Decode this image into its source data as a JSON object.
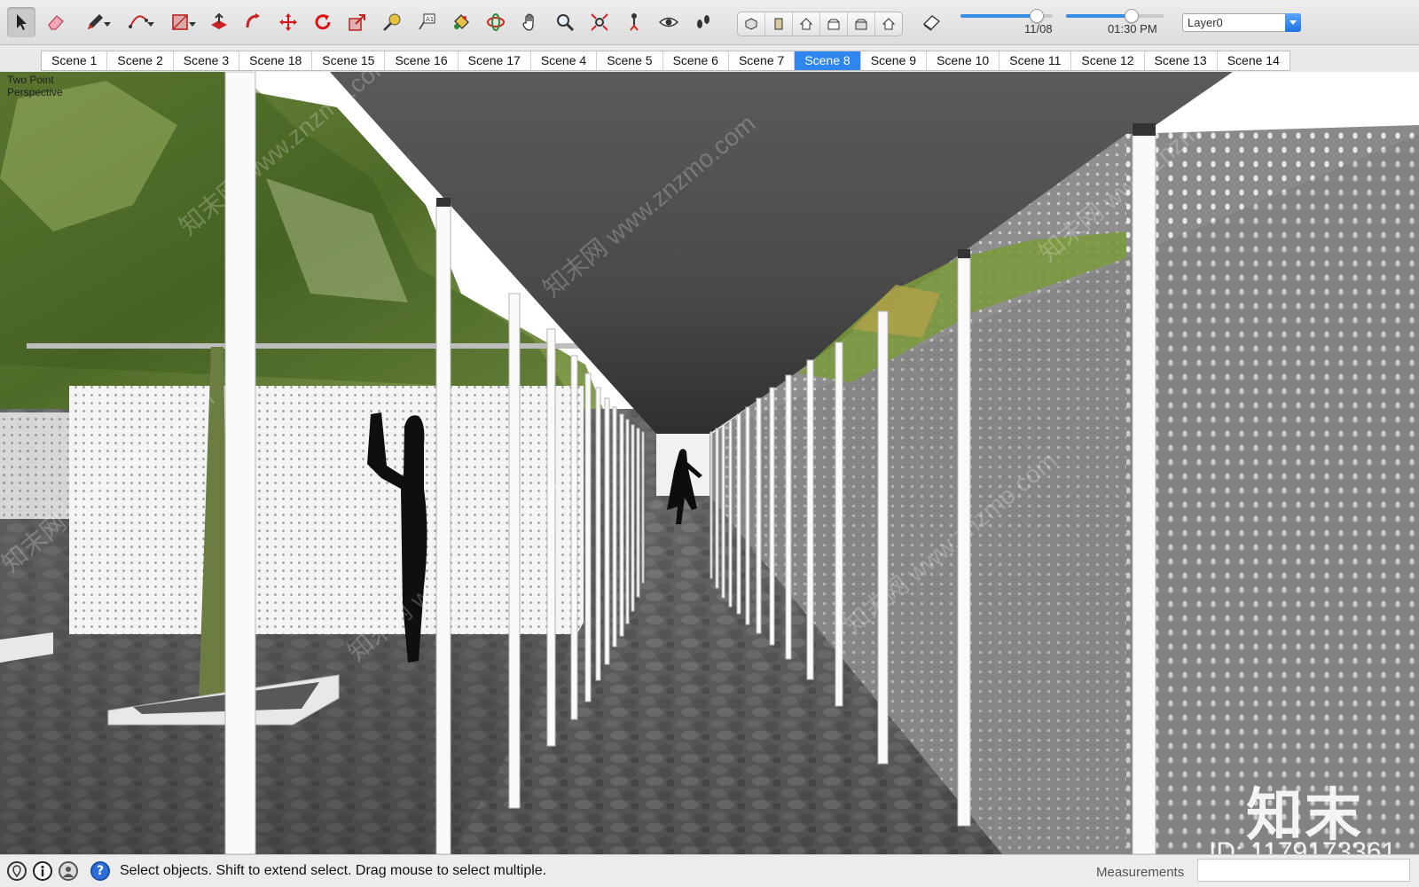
{
  "toolbar": {
    "tools": [
      {
        "name": "select-tool",
        "icon": "arrow-cursor-icon"
      },
      {
        "name": "eraser-tool",
        "icon": "eraser-icon"
      },
      {
        "name": "line-tool",
        "icon": "pencil-icon"
      },
      {
        "name": "arc-tool",
        "icon": "arc-icon"
      },
      {
        "name": "rectangle-tool",
        "icon": "rectangle-icon"
      },
      {
        "name": "push-pull-tool",
        "icon": "push-pull-icon"
      },
      {
        "name": "follow-me-tool",
        "icon": "follow-me-icon"
      },
      {
        "name": "move-tool",
        "icon": "move-icon"
      },
      {
        "name": "rotate-tool",
        "icon": "rotate-icon"
      },
      {
        "name": "scale-tool",
        "icon": "scale-icon"
      },
      {
        "name": "tape-measure-tool",
        "icon": "tape-measure-icon"
      },
      {
        "name": "text-tool",
        "icon": "text-icon"
      },
      {
        "name": "paint-bucket-tool",
        "icon": "paint-bucket-icon"
      },
      {
        "name": "orbit-tool",
        "icon": "orbit-icon"
      },
      {
        "name": "pan-tool",
        "icon": "hand-icon"
      },
      {
        "name": "zoom-tool",
        "icon": "magnifier-icon"
      },
      {
        "name": "zoom-extents-tool",
        "icon": "zoom-extents-icon"
      },
      {
        "name": "position-camera-tool",
        "icon": "position-camera-icon"
      },
      {
        "name": "look-around-tool",
        "icon": "eye-icon"
      },
      {
        "name": "walk-tool",
        "icon": "footprints-icon"
      }
    ],
    "views": [
      "iso-view-icon",
      "top-view-icon",
      "front-view-icon",
      "right-view-icon",
      "back-view-icon",
      "left-view-icon"
    ],
    "date_label": "11/08",
    "time_label": "01:30 PM",
    "date_progress": 0.82,
    "time_progress": 0.66,
    "layer": "Layer0",
    "accent": "#2f86f0"
  },
  "scenes": {
    "tabs": [
      "Scene 1",
      "Scene 2",
      "Scene 3",
      "Scene 18",
      "Scene 15",
      "Scene 16",
      "Scene 17",
      "Scene 4",
      "Scene 5",
      "Scene 6",
      "Scene 7",
      "Scene 8",
      "Scene 9",
      "Scene 10",
      "Scene 11",
      "Scene 12",
      "Scene 13",
      "Scene 14"
    ],
    "active": "Scene 8"
  },
  "viewport": {
    "camera_label": "Two Point Perspective"
  },
  "watermark": {
    "repeat_text": "知末网 www.znzmo.com",
    "big_text": "知末",
    "id_text": "ID: 1179173361"
  },
  "status": {
    "text": "Select objects. Shift to extend select. Drag mouse to select multiple.",
    "measurements_label": "Measurements",
    "measurements_value": ""
  }
}
